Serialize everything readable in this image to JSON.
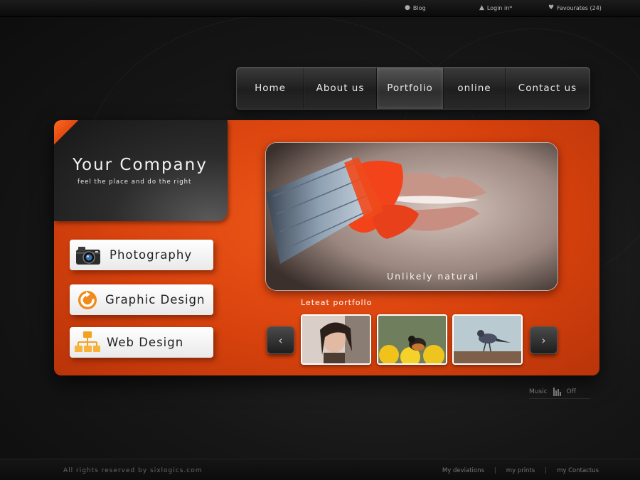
{
  "topbar": {
    "blog": "Blog",
    "login": "Login in*",
    "favourites": "Favourates (24)"
  },
  "nav": {
    "items": [
      {
        "label": "Home"
      },
      {
        "label": "About us"
      },
      {
        "label": "Portfolio"
      },
      {
        "label": "online"
      },
      {
        "label": "Contact us"
      }
    ],
    "active_index": 2
  },
  "brand": {
    "title": "Your Company",
    "tagline": "feel the place and do the right"
  },
  "services": [
    {
      "label": "Photography",
      "icon": "camera-icon"
    },
    {
      "label": "Graphic Design",
      "icon": "refresh-arrow-icon"
    },
    {
      "label": "Web Design",
      "icon": "sitemap-icon"
    }
  ],
  "hero": {
    "caption": "Unlikely natural"
  },
  "portfolio": {
    "heading": "Leteat portfollo",
    "thumbs": [
      "portrait-photo",
      "bird-on-flowers-photo",
      "bird-on-post-photo"
    ]
  },
  "music": {
    "label": "Music",
    "state": "Off"
  },
  "footer": {
    "copyright": "All rights reserved by sixlogics.com",
    "links": [
      "My deviations",
      "my prints",
      "my Contactus"
    ]
  },
  "colors": {
    "accent": "#e24a10",
    "background": "#151515"
  }
}
